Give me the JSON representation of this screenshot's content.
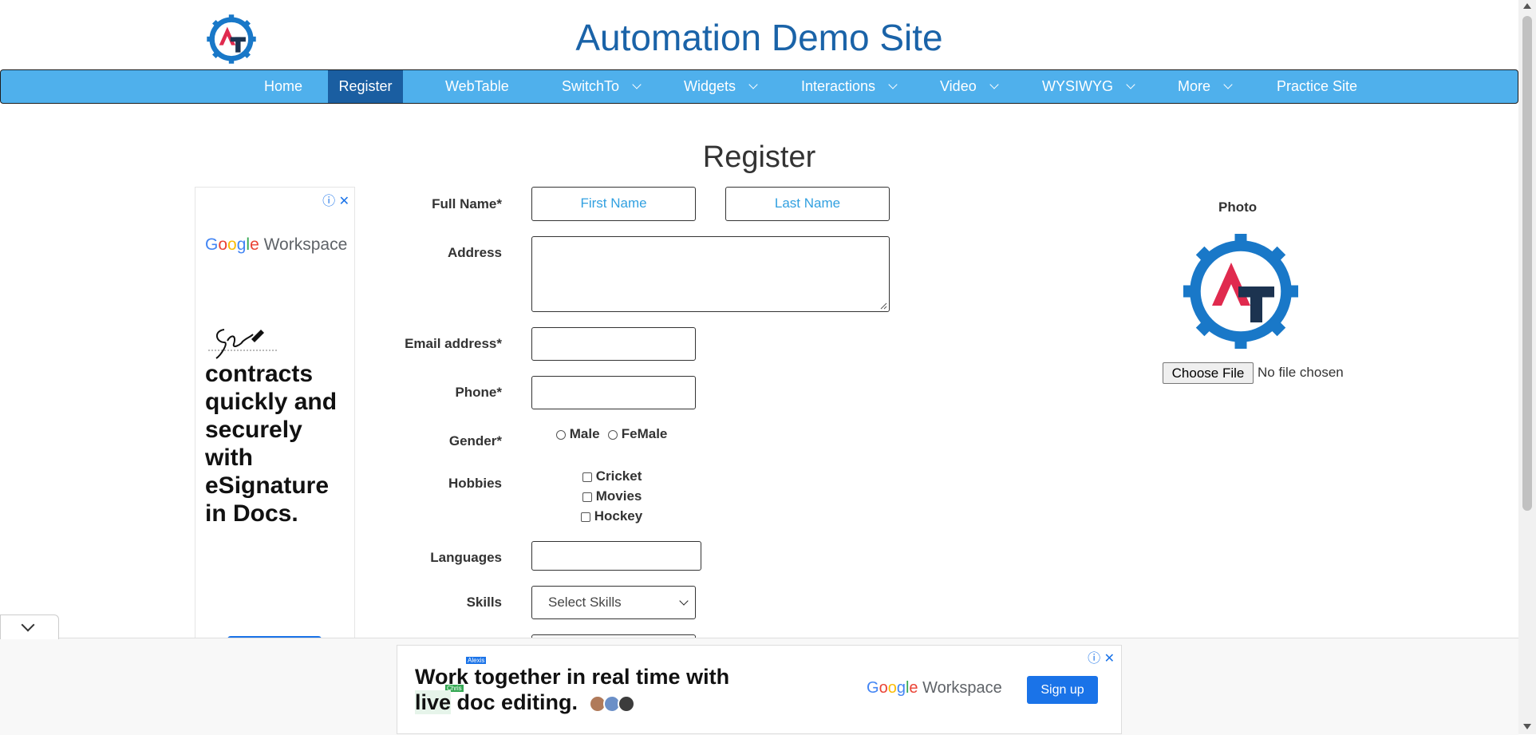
{
  "header": {
    "title": "Automation Demo Site",
    "logo_letters": "AT"
  },
  "nav": {
    "items": [
      {
        "label": "Home",
        "dropdown": false
      },
      {
        "label": "Register",
        "dropdown": false,
        "active": true
      },
      {
        "label": "WebTable",
        "dropdown": false
      },
      {
        "label": "SwitchTo",
        "dropdown": true
      },
      {
        "label": "Widgets",
        "dropdown": true
      },
      {
        "label": "Interactions",
        "dropdown": true
      },
      {
        "label": "Video",
        "dropdown": true
      },
      {
        "label": "WYSIWYG",
        "dropdown": true
      },
      {
        "label": "More",
        "dropdown": true
      },
      {
        "label": "Practice Site",
        "dropdown": false
      }
    ],
    "bg_color": "#4fb0ec",
    "active_color": "#1a5ea1"
  },
  "page": {
    "title": "Register"
  },
  "form": {
    "full_name_label": "Full Name*",
    "first_name_placeholder": "First Name",
    "last_name_placeholder": "Last Name",
    "address_label": "Address",
    "address_value": "",
    "email_label": "Email address*",
    "email_value": "",
    "phone_label": "Phone*",
    "phone_value": "",
    "gender_label": "Gender*",
    "gender_options": [
      "Male",
      "FeMale"
    ],
    "hobbies_label": "Hobbies",
    "hobbies": [
      "Cricket",
      "Movies",
      "Hockey"
    ],
    "languages_label": "Languages",
    "languages_value": "",
    "skills_label": "Skills",
    "skills_selected": "Select Skills"
  },
  "photo": {
    "label": "Photo",
    "choose_button": "Choose File",
    "file_status": "No file chosen"
  },
  "ad_left": {
    "brand_google": "Google",
    "brand_product": "Workspace",
    "headline": "contracts quickly and securely with eSignature in Docs."
  },
  "ad_bottom": {
    "line1": "Work together in real time with",
    "line2_highlight": "live",
    "line2_rest": " doc editing.",
    "tag_alexis": "Alexis",
    "tag_chris": "Chris",
    "brand_google": "Google",
    "brand_product": "Workspace",
    "signup": "Sign up"
  }
}
